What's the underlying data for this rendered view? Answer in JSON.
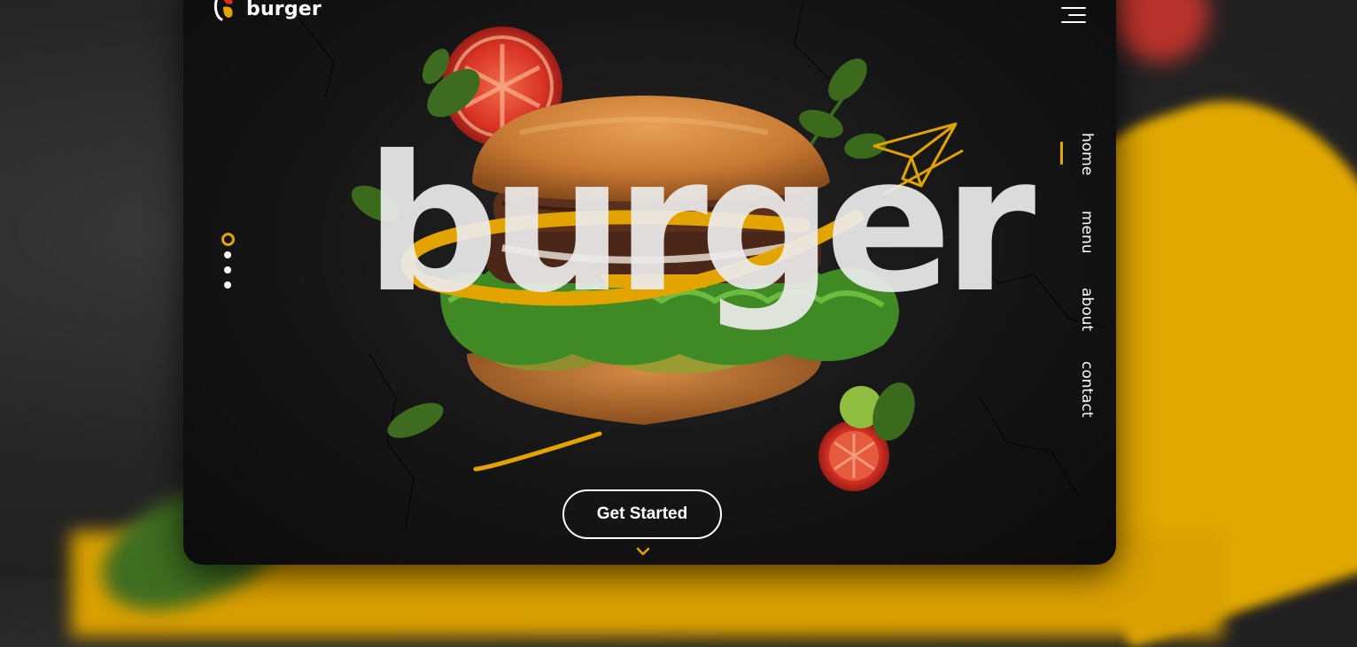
{
  "brand": {
    "name": "burger",
    "accent_color": "#e3a400",
    "logo_icon": "burger-logo-icon"
  },
  "header": {
    "menu_icon": "hamburger-menu-icon"
  },
  "nav": {
    "items": [
      {
        "label": "home",
        "active": true
      },
      {
        "label": "menu",
        "active": false
      },
      {
        "label": "about",
        "active": false
      },
      {
        "label": "contact",
        "active": false
      }
    ]
  },
  "hero": {
    "title": "burger",
    "slides_total": 4,
    "slide_active": 1,
    "cta_label": "Get Started",
    "scroll_icon": "chevron-down-icon"
  }
}
